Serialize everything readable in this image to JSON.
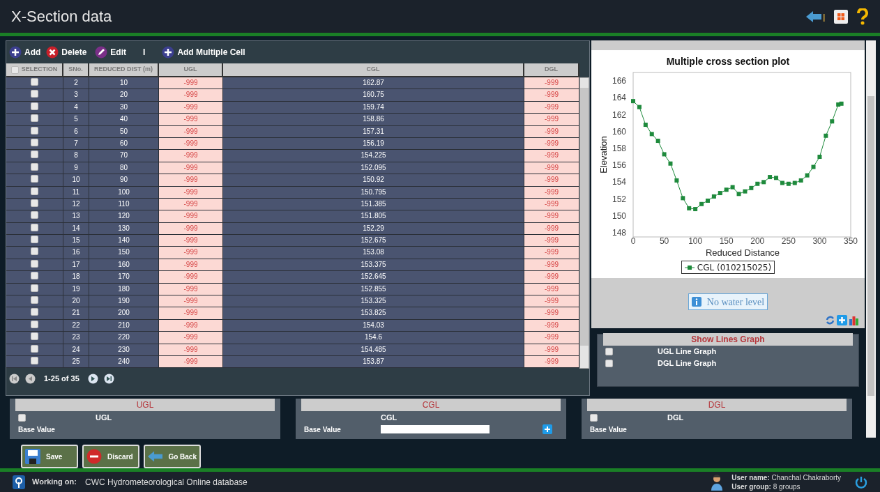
{
  "header": {
    "title": "X-Section data"
  },
  "toolbar": {
    "add": "Add",
    "delete": "Delete",
    "edit": "Edit",
    "separator": "I",
    "add_multiple": "Add Multiple Cell"
  },
  "table": {
    "select_all": {
      "checked": false
    },
    "columns": [
      "SELECTION",
      "SNo.",
      "REDUCED DIST (m)",
      "UGL",
      "CGL",
      "DGL"
    ],
    "rows": [
      {
        "checked": false,
        "sno": "2",
        "dist": "10",
        "ugl": "-999",
        "cgl": "162.87",
        "dgl": "-999"
      },
      {
        "checked": false,
        "sno": "3",
        "dist": "20",
        "ugl": "-999",
        "cgl": "160.75",
        "dgl": "-999"
      },
      {
        "checked": false,
        "sno": "4",
        "dist": "30",
        "ugl": "-999",
        "cgl": "159.74",
        "dgl": "-999"
      },
      {
        "checked": false,
        "sno": "5",
        "dist": "40",
        "ugl": "-999",
        "cgl": "158.86",
        "dgl": "-999"
      },
      {
        "checked": false,
        "sno": "6",
        "dist": "50",
        "ugl": "-999",
        "cgl": "157.31",
        "dgl": "-999"
      },
      {
        "checked": false,
        "sno": "7",
        "dist": "60",
        "ugl": "-999",
        "cgl": "156.19",
        "dgl": "-999"
      },
      {
        "checked": false,
        "sno": "8",
        "dist": "70",
        "ugl": "-999",
        "cgl": "154.225",
        "dgl": "-999"
      },
      {
        "checked": false,
        "sno": "9",
        "dist": "80",
        "ugl": "-999",
        "cgl": "152.095",
        "dgl": "-999"
      },
      {
        "checked": false,
        "sno": "10",
        "dist": "90",
        "ugl": "-999",
        "cgl": "150.92",
        "dgl": "-999"
      },
      {
        "checked": false,
        "sno": "11",
        "dist": "100",
        "ugl": "-999",
        "cgl": "150.795",
        "dgl": "-999"
      },
      {
        "checked": false,
        "sno": "12",
        "dist": "110",
        "ugl": "-999",
        "cgl": "151.385",
        "dgl": "-999"
      },
      {
        "checked": false,
        "sno": "13",
        "dist": "120",
        "ugl": "-999",
        "cgl": "151.805",
        "dgl": "-999"
      },
      {
        "checked": false,
        "sno": "14",
        "dist": "130",
        "ugl": "-999",
        "cgl": "152.29",
        "dgl": "-999"
      },
      {
        "checked": false,
        "sno": "15",
        "dist": "140",
        "ugl": "-999",
        "cgl": "152.675",
        "dgl": "-999"
      },
      {
        "checked": false,
        "sno": "16",
        "dist": "150",
        "ugl": "-999",
        "cgl": "153.08",
        "dgl": "-999"
      },
      {
        "checked": false,
        "sno": "17",
        "dist": "160",
        "ugl": "-999",
        "cgl": "153.375",
        "dgl": "-999"
      },
      {
        "checked": false,
        "sno": "18",
        "dist": "170",
        "ugl": "-999",
        "cgl": "152.645",
        "dgl": "-999"
      },
      {
        "checked": false,
        "sno": "19",
        "dist": "180",
        "ugl": "-999",
        "cgl": "152.855",
        "dgl": "-999"
      },
      {
        "checked": false,
        "sno": "20",
        "dist": "190",
        "ugl": "-999",
        "cgl": "153.325",
        "dgl": "-999"
      },
      {
        "checked": false,
        "sno": "21",
        "dist": "200",
        "ugl": "-999",
        "cgl": "153.825",
        "dgl": "-999"
      },
      {
        "checked": false,
        "sno": "22",
        "dist": "210",
        "ugl": "-999",
        "cgl": "154.03",
        "dgl": "-999"
      },
      {
        "checked": false,
        "sno": "23",
        "dist": "220",
        "ugl": "-999",
        "cgl": "154.6",
        "dgl": "-999"
      },
      {
        "checked": false,
        "sno": "24",
        "dist": "230",
        "ugl": "-999",
        "cgl": "154.485",
        "dgl": "-999"
      },
      {
        "checked": false,
        "sno": "25",
        "dist": "240",
        "ugl": "-999",
        "cgl": "153.87",
        "dgl": "-999"
      }
    ],
    "pager": "1-25 of 35"
  },
  "chart": {
    "chart_data": {
      "type": "line",
      "title": "Multiple cross section plot",
      "xlabel": "Reduced Distance",
      "ylabel": "Elevation",
      "x": [
        0,
        10,
        20,
        30,
        40,
        50,
        60,
        70,
        80,
        90,
        100,
        110,
        120,
        130,
        140,
        150,
        160,
        170,
        180,
        190,
        200,
        210,
        220,
        230,
        240,
        250,
        260,
        270,
        280,
        290,
        300,
        310,
        320,
        330,
        335
      ],
      "series": [
        {
          "name": "CGL (010215025)",
          "color": "#1e8a3c",
          "marker": "square",
          "values": [
            163.6,
            162.9,
            160.8,
            159.7,
            158.9,
            157.3,
            156.2,
            154.2,
            152.1,
            150.9,
            150.8,
            151.4,
            151.8,
            152.3,
            152.7,
            153.1,
            153.4,
            152.6,
            152.9,
            153.3,
            153.8,
            154,
            154.6,
            154.5,
            153.9,
            153.8,
            153.9,
            154.2,
            154.8,
            155.8,
            157,
            159.5,
            161.2,
            163.2,
            163.3
          ]
        }
      ],
      "xlim": [
        0,
        350
      ],
      "ylim": [
        147.5,
        167
      ],
      "xticks": [
        0,
        50,
        100,
        150,
        200,
        250,
        300,
        350
      ],
      "yticks": [
        148,
        150,
        152,
        154,
        156,
        158,
        160,
        162,
        164,
        166
      ]
    }
  },
  "water_level": "No water level",
  "lines_graph": {
    "title": "Show Lines Graph",
    "options": [
      {
        "label": "UGL Line Graph",
        "checked": false
      },
      {
        "label": "DGL Line Graph",
        "checked": false
      }
    ]
  },
  "sections": [
    {
      "kind": "checkbox",
      "title": "UGL",
      "label": "UGL",
      "checked": false,
      "base": "Base Value"
    },
    {
      "kind": "input",
      "title": "CGL",
      "label": "CGL",
      "base": "Base Value"
    },
    {
      "kind": "checkbox",
      "title": "DGL",
      "label": "DGL",
      "checked": false,
      "base": "Base Value"
    }
  ],
  "actions": [
    "Save",
    "Discard",
    "Go Back"
  ],
  "footer": {
    "working_label": "Working on:",
    "working_value": "CWC Hydrometeorological Online database",
    "user_label": "User name:",
    "user_value": "Chanchal Chakraborty",
    "group_label": "User group:",
    "group_value": "8 groups"
  }
}
